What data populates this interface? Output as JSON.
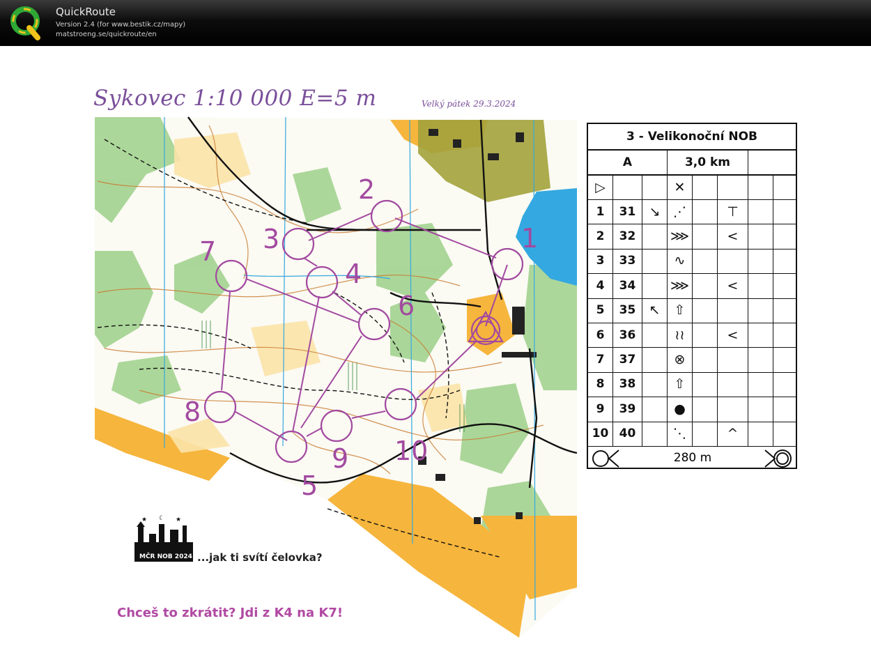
{
  "app": {
    "name": "QuickRoute",
    "version_line": "Version 2.4  (for www.bestik.cz/mapy)",
    "url_line": "matstroeng.se/quickroute/en",
    "logo_letter": "Q"
  },
  "map": {
    "title": "Sykovec  1:10 000  E=5 m",
    "date": "Velký pátek 29.3.2024",
    "course_color": "#a24aa0",
    "control_labels": [
      "1",
      "2",
      "3",
      "4",
      "5",
      "6",
      "7",
      "8",
      "9",
      "10"
    ],
    "event_logo_text": "MČR NOB 2024",
    "slogan": "...jak ti svítí čelovka?",
    "shortcut_note": "Chceš to zkrátit? Jdi z K4 na K7!"
  },
  "description_sheet": {
    "title": "3 - Velikonoční NOB",
    "class": "A",
    "length": "3,0 km",
    "start_symbol": "▷",
    "start_feature": "✕",
    "finish_distance": "280 m",
    "rows": [
      {
        "no": "1",
        "code": "31",
        "c": "↘",
        "d": "⋰",
        "g": "⊤"
      },
      {
        "no": "2",
        "code": "32",
        "c": "",
        "d": "⋙",
        "g": "<"
      },
      {
        "no": "3",
        "code": "33",
        "c": "",
        "d": "∿",
        "g": ""
      },
      {
        "no": "4",
        "code": "34",
        "c": "",
        "d": "⋙",
        "g": "<"
      },
      {
        "no": "5",
        "code": "35",
        "c": "↖",
        "d": "⇧",
        "g": ""
      },
      {
        "no": "6",
        "code": "36",
        "c": "",
        "d": "≀≀",
        "g": "<"
      },
      {
        "no": "7",
        "code": "37",
        "c": "",
        "d": "⊗",
        "g": ""
      },
      {
        "no": "8",
        "code": "38",
        "c": "",
        "d": "⇧",
        "g": ""
      },
      {
        "no": "9",
        "code": "39",
        "c": "",
        "d": "●",
        "g": ""
      },
      {
        "no": "10",
        "code": "40",
        "c": "",
        "d": "⋱",
        "g": "^"
      }
    ]
  }
}
